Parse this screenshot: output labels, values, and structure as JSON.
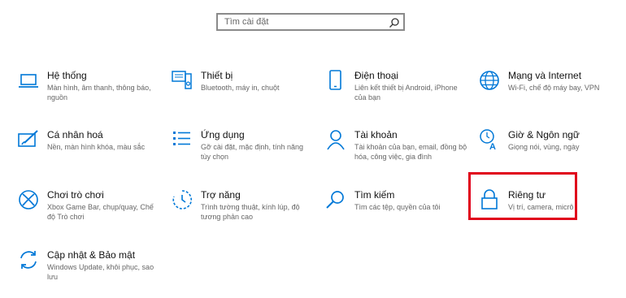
{
  "search": {
    "placeholder": "Tìm cài đặt",
    "icon": "search-icon"
  },
  "accent": "#0078d7",
  "highlight_color": "#e0001b",
  "tiles": [
    {
      "title": "Hệ thống",
      "desc": "Màn hình, âm thanh, thông báo, nguồn",
      "icon": "laptop-icon"
    },
    {
      "title": "Thiết bị",
      "desc": "Bluetooth, máy in, chuột",
      "icon": "devices-icon"
    },
    {
      "title": "Điện thoại",
      "desc": "Liên kết thiết bị Android, iPhone của bạn",
      "icon": "phone-icon"
    },
    {
      "title": "Mạng và Internet",
      "desc": "Wi-Fi, chế độ máy bay, VPN",
      "icon": "globe-icon"
    },
    {
      "title": "Cá nhân hoá",
      "desc": "Nền, màn hình khóa, màu sắc",
      "icon": "personalization-icon"
    },
    {
      "title": "Ứng dụng",
      "desc": "Gỡ cài đặt, mặc định, tính năng tùy chọn",
      "icon": "apps-icon"
    },
    {
      "title": "Tài khoản",
      "desc": "Tài khoản của bạn, email, đồng bộ hóa, công việc, gia đình",
      "icon": "person-icon"
    },
    {
      "title": "Giờ & Ngôn ngữ",
      "desc": "Giọng nói, vùng, ngày",
      "icon": "time-language-icon"
    },
    {
      "title": "Chơi trò chơi",
      "desc": "Xbox Game Bar, chụp/quay, Chế độ Trò chơi",
      "icon": "xbox-icon"
    },
    {
      "title": "Trợ năng",
      "desc": "Trình tường thuật, kính lúp, độ tương phản cao",
      "icon": "accessibility-icon"
    },
    {
      "title": "Tìm kiếm",
      "desc": "Tìm các tệp, quyền của tôi",
      "icon": "search-icon"
    },
    {
      "title": "Riêng tư",
      "desc": "Vị trí, camera, micrô",
      "icon": "lock-icon"
    },
    {
      "title": "Cập nhật & Bảo mật",
      "desc": "Windows Update, khôi phục, sao lưu",
      "icon": "update-icon"
    }
  ]
}
